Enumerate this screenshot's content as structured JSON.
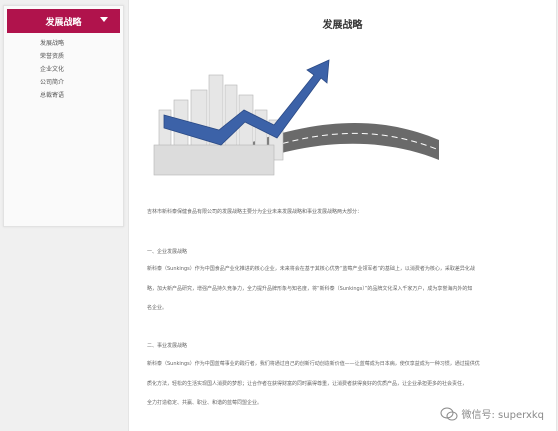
{
  "sidebar": {
    "header": "发展战略",
    "items": [
      "发展战略",
      "荣誉资质",
      "企业文化",
      "公司简介",
      "总裁寄语"
    ]
  },
  "main": {
    "title": "发展战略",
    "intro": "吉林市新科泰保健食品有限公司的发展战略主要分为企业未来发展战略和事业发展战略两大部分：",
    "s1_title": "一、企业发展战略",
    "s1_p1": "新科泰（Sunkings）作为中国食品产业化推进的核心企业，未来将会在基于其核心优势“蓝莓产业领军者”的基础上，以消费者为核心，采取差异化战",
    "s1_p2": "略，加大新产品研究，增强产品持久竞争力，全力提升品牌形象与知名度，将“新科泰（Sunkings）”的品牌文化深入千家万户，成为享誉海内外的知",
    "s1_p3": "名企业。",
    "s2_title": "二、事业发展战略",
    "s2_p1": "新科泰（Sunkings）作为中国蓝莓事业的践行者，我们将通过自己的创新行动创造新价值——让蓝莓成为日本病，使仅享益成为一种习惯，通过提供优",
    "s2_p2": "质化方法，轻松的生活实现国人消费的梦想；让合作者在获得财富的同时赢得尊重，让消费者获得良好的优质产品，让企业承担更多的社会责任，",
    "s2_p3": "全力打造稳定、共赢、职业、和谐的蓝莓同盟企业。"
  },
  "watermark": "微信号: superxkq"
}
